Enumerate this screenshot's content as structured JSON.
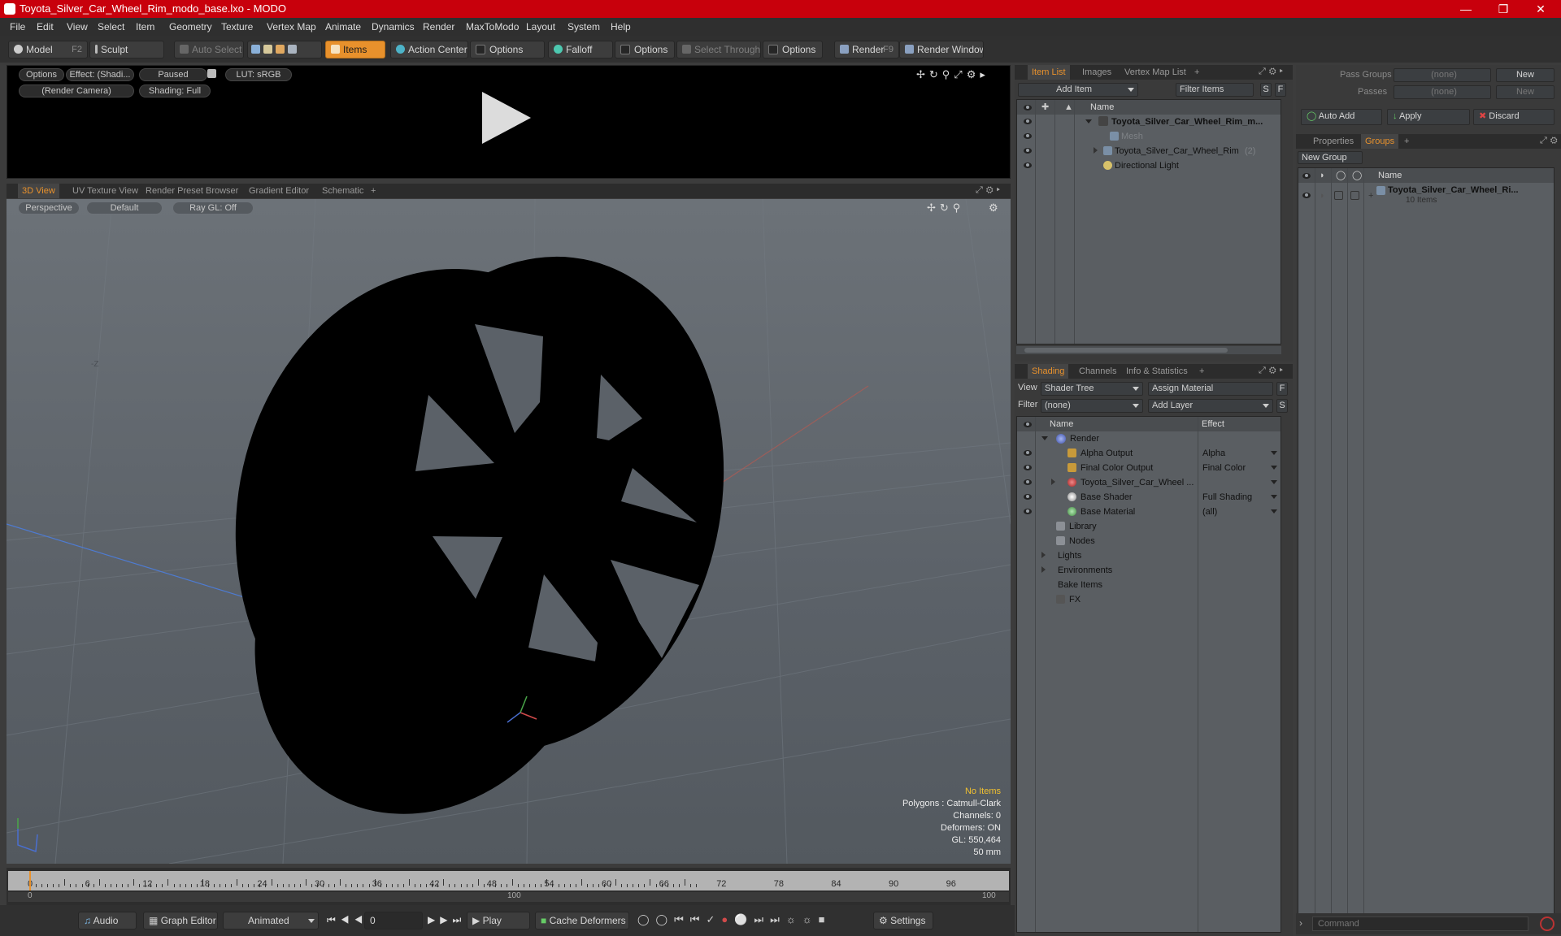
{
  "window": {
    "title": "Toyota_Silver_Car_Wheel_Rim_modo_base.lxo - MODO"
  },
  "menu": [
    "File",
    "Edit",
    "View",
    "Select",
    "Item",
    "Geometry",
    "Texture",
    "Vertex Map",
    "Animate",
    "Dynamics",
    "Render",
    "MaxToModo",
    "Layout",
    "System",
    "Help"
  ],
  "toolbar": {
    "model": "Model",
    "model_key": "F2",
    "sculpt": "Sculpt",
    "auto_select": "Auto Select",
    "items": "Items",
    "action_center": "Action Center",
    "options1": "Options",
    "falloff": "Falloff",
    "options2": "Options",
    "select_through": "Select Through",
    "options3": "Options",
    "render": "Render",
    "render_key": "F9",
    "render_window": "Render Window"
  },
  "render_view": {
    "options": "Options",
    "effect": "Effect: (Shadi...",
    "paused": "Paused",
    "lut": "LUT: sRGB",
    "camera": "(Render Camera)",
    "shading": "Shading: Full"
  },
  "view_tabs": [
    "3D View",
    "UV Texture View",
    "Render Preset Browser",
    "Gradient Editor",
    "Schematic",
    "+"
  ],
  "viewport": {
    "perspective": "Perspective",
    "default": "Default",
    "raygl": "Ray GL: Off",
    "axis_label": "-Z",
    "hud": {
      "no_items": "No Items",
      "polygons": "Polygons : Catmull-Clark",
      "channels": "Channels: 0",
      "deformers": "Deformers: ON",
      "gl": "GL: 550,464",
      "lens": "50 mm"
    }
  },
  "timeline": {
    "ticks": [
      "0",
      "6",
      "12",
      "18",
      "24",
      "30",
      "36",
      "42",
      "48",
      "54",
      "60",
      "66",
      "72",
      "78",
      "84",
      "90",
      "96"
    ],
    "range_start": "0",
    "range_mid": "100",
    "range_end": "100"
  },
  "bottombar": {
    "audio": "Audio",
    "graph_editor": "Graph Editor",
    "animated": "Animated",
    "frame": "0",
    "play": "Play",
    "cache_deformers": "Cache Deformers",
    "settings": "Settings"
  },
  "item_list": {
    "tabs": [
      "Item List",
      "Images",
      "Vertex Map List",
      "+"
    ],
    "add_item": "Add Item",
    "filter": "Filter Items",
    "s": "S",
    "f": "F",
    "col_name": "Name",
    "rows": [
      {
        "label": "Toyota_Silver_Car_Wheel_Rim_m...",
        "count": ""
      },
      {
        "label": "Mesh",
        "count": ""
      },
      {
        "label": "Toyota_Silver_Car_Wheel_Rim",
        "count": "(2)"
      },
      {
        "label": "Directional Light",
        "count": ""
      }
    ]
  },
  "shading": {
    "tabs": [
      "Shading",
      "Channels",
      "Info & Statistics",
      "+"
    ],
    "view_label": "View",
    "view_value": "Shader Tree",
    "assign_material": "Assign Material",
    "f": "F",
    "filter_label": "Filter",
    "filter_value": "(none)",
    "add_layer": "Add Layer",
    "s": "S",
    "col_name": "Name",
    "col_effect": "Effect",
    "rows": [
      {
        "name": "Render",
        "effect": ""
      },
      {
        "name": "Alpha Output",
        "effect": "Alpha"
      },
      {
        "name": "Final Color Output",
        "effect": "Final Color"
      },
      {
        "name": "Toyota_Silver_Car_Wheel ...",
        "effect": ""
      },
      {
        "name": "Base Shader",
        "effect": "Full Shading"
      },
      {
        "name": "Base Material",
        "effect": "(all)"
      },
      {
        "name": "Library",
        "effect": ""
      },
      {
        "name": "Nodes",
        "effect": ""
      },
      {
        "name": "Lights",
        "effect": ""
      },
      {
        "name": "Environments",
        "effect": ""
      },
      {
        "name": "Bake Items",
        "effect": ""
      },
      {
        "name": "FX",
        "effect": ""
      }
    ]
  },
  "groups": {
    "pass_groups_label": "Pass Groups",
    "pass_groups_value": "(none)",
    "new": "New",
    "passes_label": "Passes",
    "passes_value": "(none)",
    "new2": "New",
    "auto_add": "Auto Add",
    "apply": "Apply",
    "discard": "Discard",
    "tabs": [
      "Properties",
      "Groups",
      "+"
    ],
    "new_group": "New Group",
    "col_name": "Name",
    "group_name": "Toyota_Silver_Car_Wheel_Ri...",
    "group_count": "10 Items"
  },
  "command": {
    "placeholder": "Command"
  }
}
